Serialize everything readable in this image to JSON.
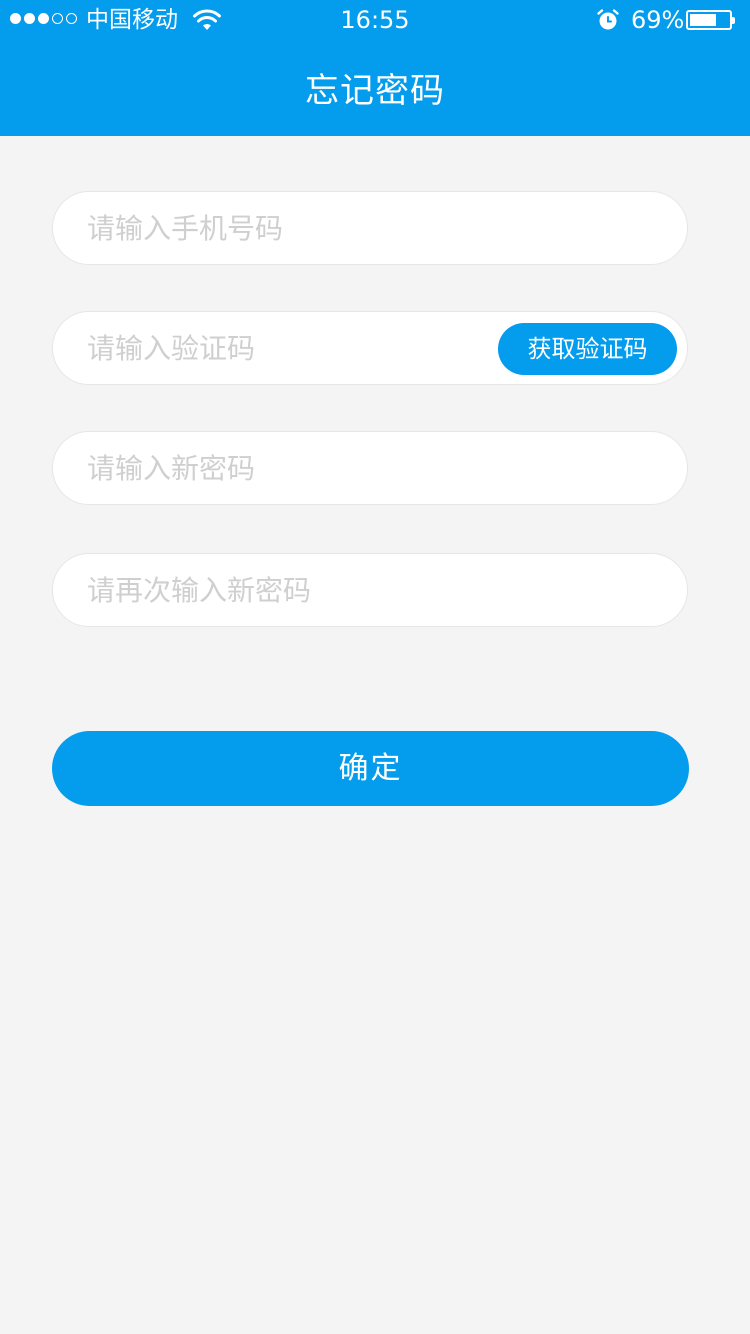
{
  "status_bar": {
    "carrier": "中国移动",
    "time": "16:55",
    "battery_percent": "69%",
    "battery_level": 0.69,
    "signal_strength": 3,
    "signal_max": 5,
    "icons": [
      "wifi-icon",
      "alarm-icon",
      "battery-icon"
    ]
  },
  "header": {
    "title": "忘记密码"
  },
  "form": {
    "phone_placeholder": "请输入手机号码",
    "code_placeholder": "请输入验证码",
    "get_code_label": "获取验证码",
    "new_password_placeholder": "请输入新密码",
    "confirm_password_placeholder": "请再次输入新密码",
    "submit_label": "确定"
  },
  "colors": {
    "accent": "#049cec",
    "background": "#f4f4f4",
    "field_background": "#ffffff",
    "placeholder": "#cfcfcf"
  }
}
